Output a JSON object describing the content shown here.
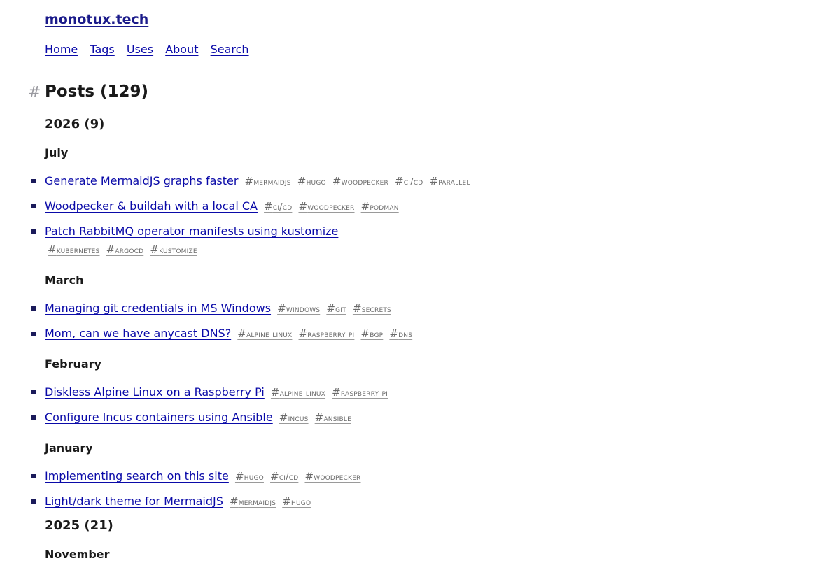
{
  "site": {
    "title": "monotux.tech"
  },
  "nav": [
    "Home",
    "Tags",
    "Uses",
    "About",
    "Search"
  ],
  "page": {
    "hash": "#",
    "heading": "Posts (129)"
  },
  "years": [
    {
      "label": "2026 (9)",
      "months": [
        {
          "label": "July",
          "posts": [
            {
              "title": "Generate MermaidJS graphs faster",
              "tags": [
                "mermaidjs",
                "hugo",
                "woodpecker",
                "ci/cd",
                "parallel"
              ]
            },
            {
              "title": "Woodpecker & buildah with a local CA",
              "tags": [
                "ci/cd",
                "woodpecker",
                "podman"
              ]
            },
            {
              "title": "Patch RabbitMQ operator manifests using kustomize",
              "tags": [
                "kubernetes",
                "argocd",
                "kustomize"
              ]
            }
          ]
        },
        {
          "label": "March",
          "posts": [
            {
              "title": "Managing git credentials in MS Windows",
              "tags": [
                "windows",
                "git",
                "secrets"
              ]
            },
            {
              "title": "Mom, can we have anycast DNS?",
              "tags": [
                "alpine linux",
                "raspberry pi",
                "bgp",
                "dns"
              ]
            }
          ]
        },
        {
          "label": "February",
          "posts": [
            {
              "title": "Diskless Alpine Linux on a Raspberry Pi",
              "tags": [
                "alpine linux",
                "raspberry pi"
              ]
            },
            {
              "title": "Configure Incus containers using Ansible",
              "tags": [
                "incus",
                "ansible"
              ]
            }
          ]
        },
        {
          "label": "January",
          "posts": [
            {
              "title": "Implementing search on this site",
              "tags": [
                "hugo",
                "ci/cd",
                "woodpecker"
              ]
            },
            {
              "title": "Light/dark theme for MermaidJS",
              "tags": [
                "mermaidjs",
                "hugo"
              ]
            }
          ]
        }
      ]
    },
    {
      "label": "2025 (21)",
      "months": [
        {
          "label": "November",
          "posts": []
        }
      ]
    }
  ]
}
